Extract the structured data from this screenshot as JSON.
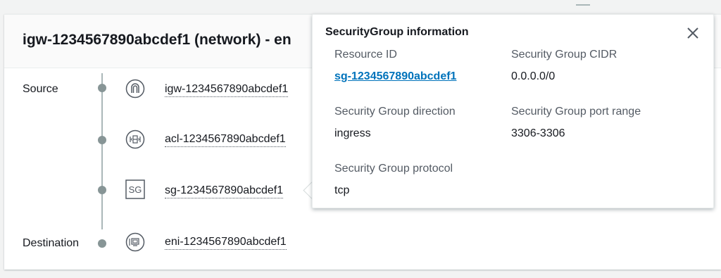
{
  "header": {
    "title": "igw-1234567890abcdef1 (network) - en"
  },
  "path": {
    "source_label": "Source",
    "destination_label": "Destination",
    "hops": [
      {
        "name": "igw-1234567890abcdef1",
        "icon": "internet-gateway-icon"
      },
      {
        "name": "acl-1234567890abcdef1",
        "icon": "network-acl-icon"
      },
      {
        "name": "sg-1234567890abcdef1",
        "icon": "security-group-icon",
        "icon_text": "SG"
      },
      {
        "name": "eni-1234567890abcdef1",
        "icon": "network-interface-icon"
      }
    ]
  },
  "popover": {
    "title": "SecurityGroup information",
    "close_icon": "close-icon",
    "fields": {
      "resource_id": {
        "label": "Resource ID",
        "value": "sg-1234567890abcdef1"
      },
      "cidr": {
        "label": "Security Group CIDR",
        "value": "0.0.0.0/0"
      },
      "direction": {
        "label": "Security Group direction",
        "value": "ingress"
      },
      "port_range": {
        "label": "Security Group port range",
        "value": "3306-3306"
      },
      "protocol": {
        "label": "Security Group protocol",
        "value": "tcp"
      }
    }
  },
  "colors": {
    "link": "#0073bb",
    "text": "#16191f",
    "muted": "#545b64",
    "line": "#aab7b8"
  }
}
